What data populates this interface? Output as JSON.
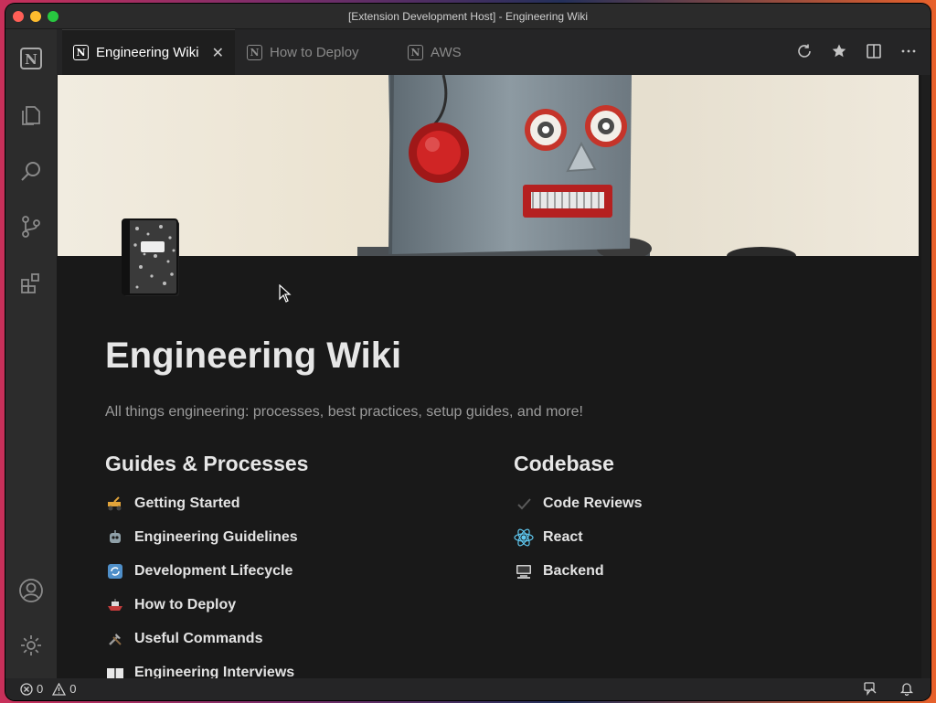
{
  "window": {
    "title": "[Extension Development Host] - Engineering Wiki"
  },
  "tabs": [
    {
      "label": "Engineering Wiki",
      "active": true
    },
    {
      "label": "How to Deploy",
      "active": false
    },
    {
      "label": "AWS",
      "active": false
    }
  ],
  "page": {
    "title": "Engineering Wiki",
    "subtitle": "All things engineering: processes, best practices, setup guides, and more!"
  },
  "guides": {
    "heading": "Guides & Processes",
    "items": [
      {
        "label": "Getting Started",
        "icon": "construction-icon"
      },
      {
        "label": "Engineering Guidelines",
        "icon": "robot-icon"
      },
      {
        "label": "Development Lifecycle",
        "icon": "cycle-icon"
      },
      {
        "label": "How to Deploy",
        "icon": "ship-icon"
      },
      {
        "label": "Useful Commands",
        "icon": "tools-icon"
      },
      {
        "label": "Engineering Interviews",
        "icon": "book-icon"
      }
    ]
  },
  "codebase": {
    "heading": "Codebase",
    "items": [
      {
        "label": "Code Reviews",
        "icon": "check-icon"
      },
      {
        "label": "React",
        "icon": "react-icon"
      },
      {
        "label": "Backend",
        "icon": "computer-icon"
      }
    ]
  },
  "status": {
    "errors": "0",
    "warnings": "0"
  }
}
